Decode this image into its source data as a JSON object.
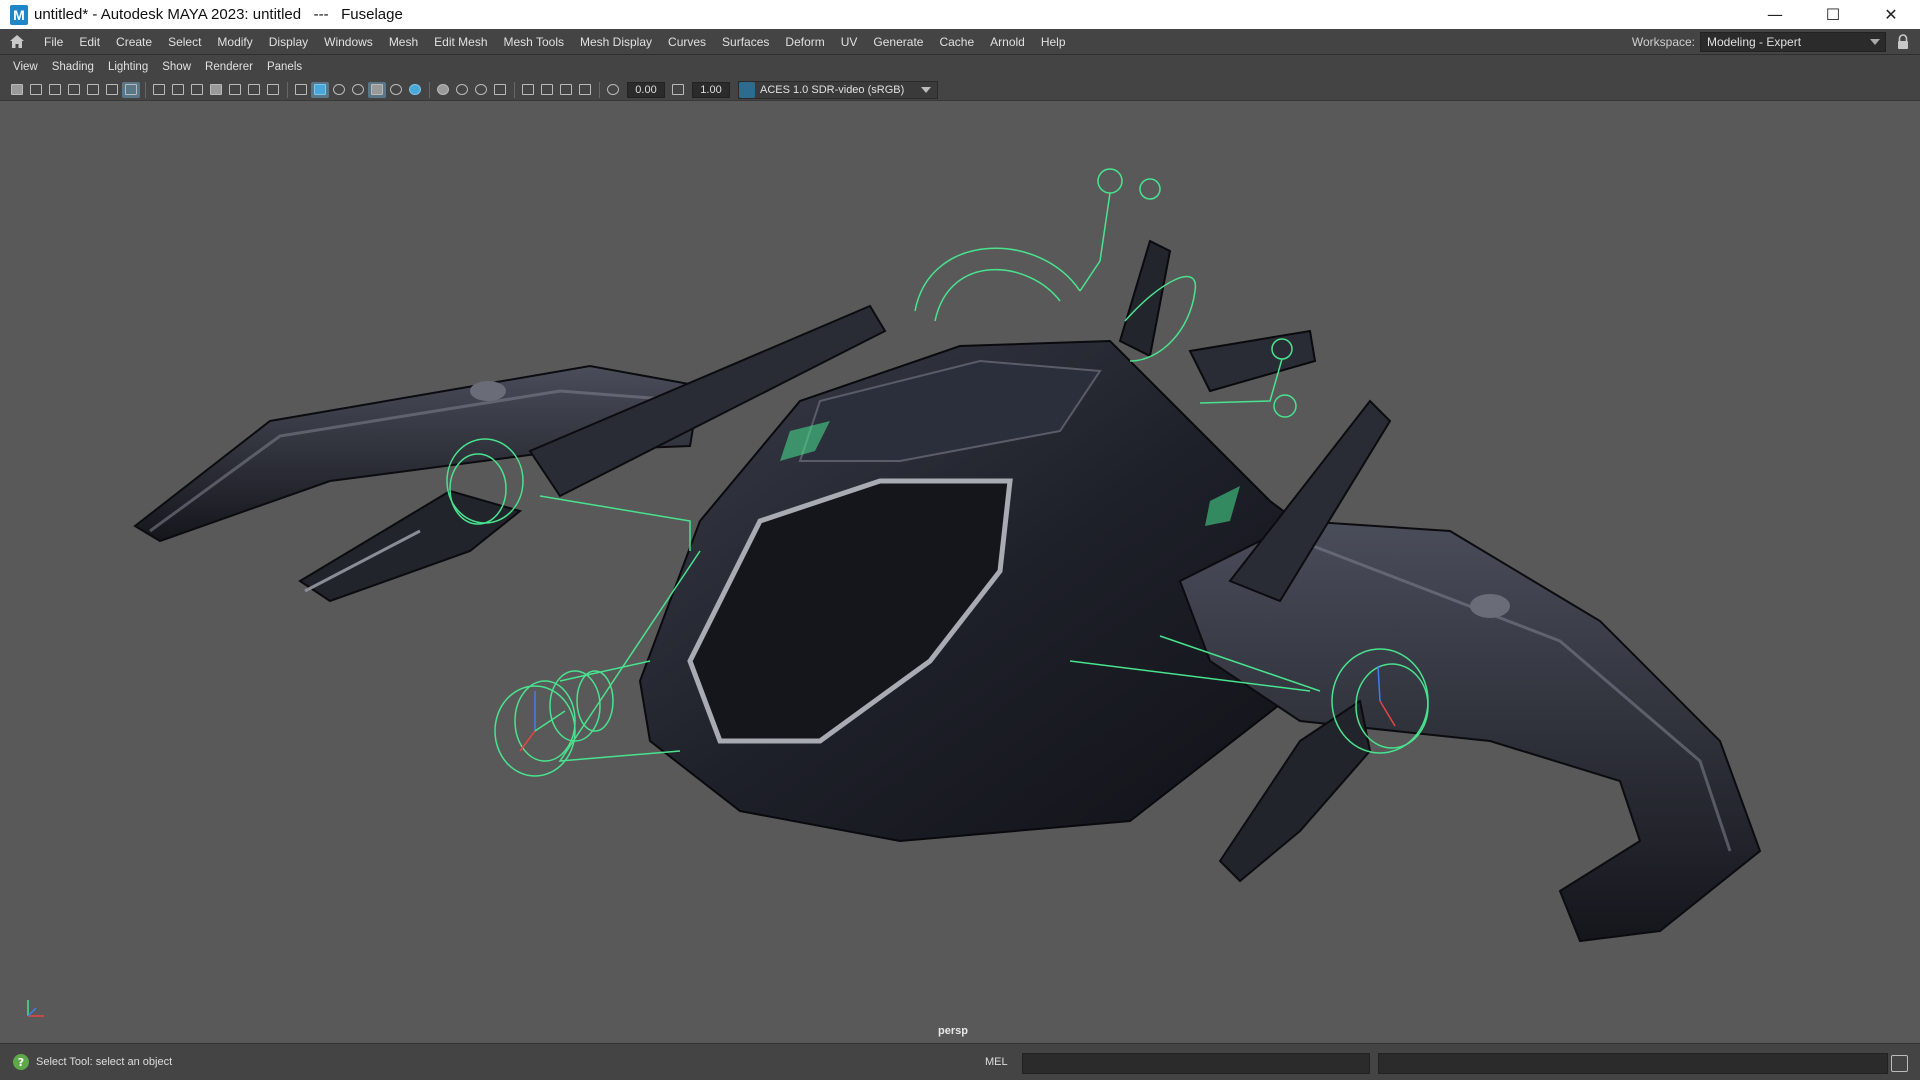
{
  "window": {
    "logo_letter": "M",
    "title": "untitled* - Autodesk MAYA 2023: untitled   ---   Fuselage",
    "minimize": "—",
    "maximize": "☐",
    "close": "✕"
  },
  "menubar": {
    "items": [
      "File",
      "Edit",
      "Create",
      "Select",
      "Modify",
      "Display",
      "Windows",
      "Mesh",
      "Edit Mesh",
      "Mesh Tools",
      "Mesh Display",
      "Curves",
      "Surfaces",
      "Deform",
      "UV",
      "Generate",
      "Cache",
      "Arnold",
      "Help"
    ],
    "workspace_label": "Workspace:",
    "workspace_value": "Modeling - Expert"
  },
  "panel_menu": {
    "items": [
      "View",
      "Shading",
      "Lighting",
      "Show",
      "Renderer",
      "Panels"
    ]
  },
  "viewport_toolbar": {
    "exposure": "0.00",
    "gamma": "1.00",
    "color_space": "ACES 1.0 SDR-video (sRGB)"
  },
  "viewport": {
    "camera": "persp",
    "background_color": "#595959",
    "selection_color": "#49e38f"
  },
  "status": {
    "help_line": "Select Tool: select an object",
    "command_language": "MEL",
    "command_value": ""
  },
  "colors": {
    "ui_bg": "#444444",
    "field_bg": "#2b2b2b",
    "accent_blue": "#1d87c9"
  }
}
